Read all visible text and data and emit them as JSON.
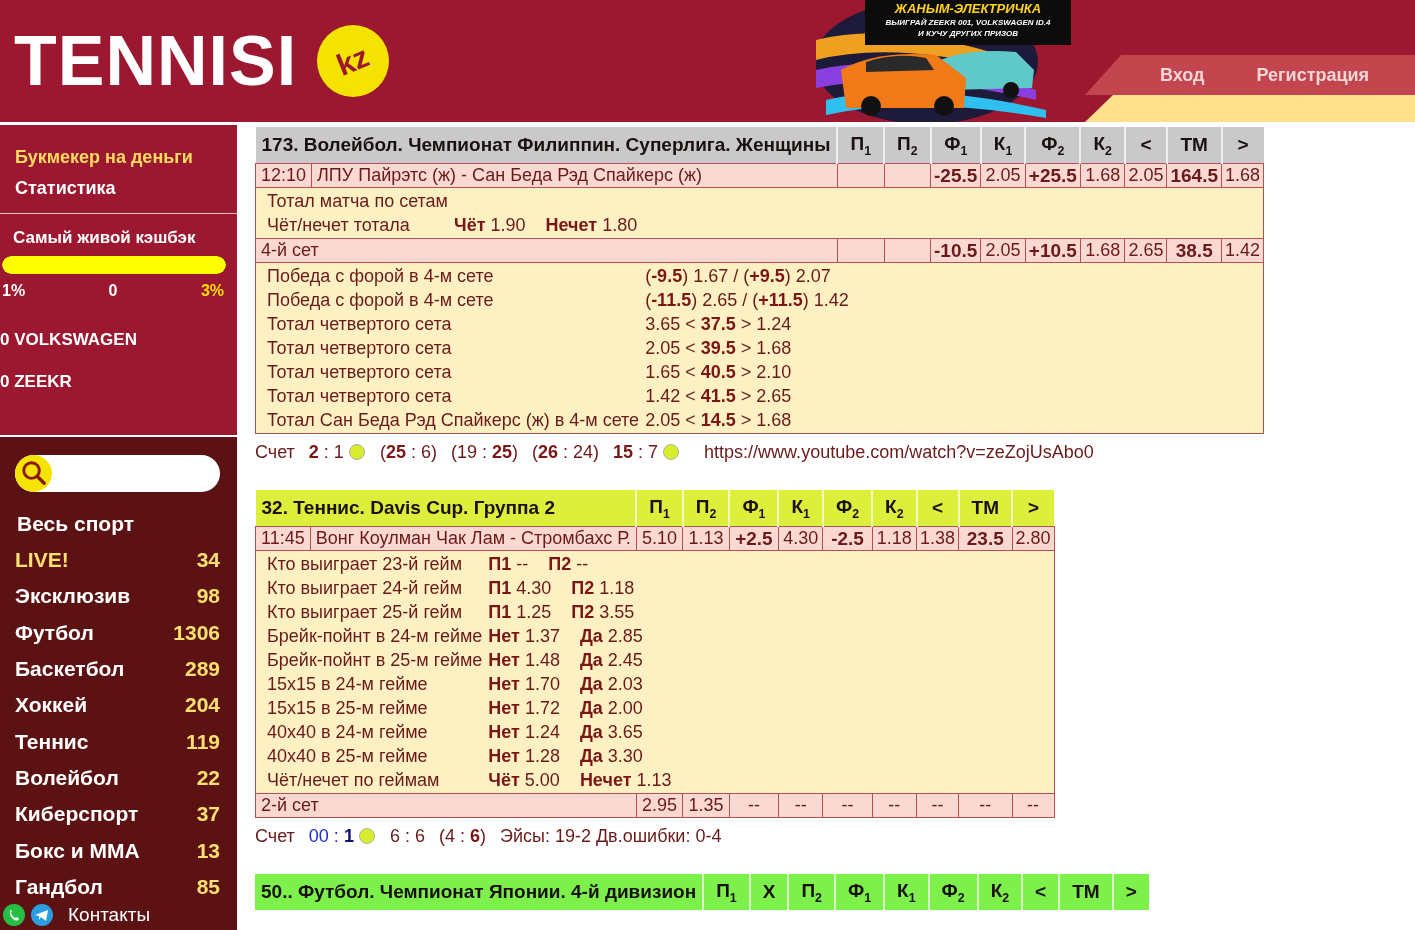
{
  "header": {
    "logo": "TENNISI",
    "badge": "kz",
    "promo": {
      "title": "ЖАНЫМ-ЭЛЕКТРИЧКА",
      "lines": [
        "ВЫИГРАЙ ZEEKR 001, VOLKSWAGEN ID.4",
        "И КУЧУ ДРУГИХ ПРИЗОВ"
      ]
    },
    "nav": [
      "Вход",
      "Регистрация"
    ]
  },
  "sidebar": {
    "links": [
      {
        "label": "Букмекер на деньги",
        "highlight": true
      },
      {
        "label": "Статистика",
        "highlight": false
      }
    ],
    "cashback": {
      "title": "Самый живой кэшбэк",
      "level": 1,
      "marks": [
        {
          "label": "1%",
          "highlight": false
        },
        {
          "label": "0",
          "highlight": false
        },
        {
          "label": "3%",
          "highlight": true
        }
      ],
      "prizes": [
        "0 VOLKSWAGEN",
        "0 ZEEKR"
      ]
    },
    "all_sports": "Весь спорт",
    "sports": [
      {
        "label": "LIVE!",
        "count": "34",
        "highlight": true
      },
      {
        "label": "Эксклюзив",
        "count": "98",
        "highlight": false
      },
      {
        "label": "Футбол",
        "count": "1306",
        "highlight": false
      },
      {
        "label": "Баскетбол",
        "count": "289",
        "highlight": false
      },
      {
        "label": "Хоккей",
        "count": "204",
        "highlight": false
      },
      {
        "label": "Теннис",
        "count": "119",
        "highlight": false
      },
      {
        "label": "Волейбол",
        "count": "22",
        "highlight": false
      },
      {
        "label": "Киберспорт",
        "count": "37",
        "highlight": false
      },
      {
        "label": "Бокс и MMA",
        "count": "13",
        "highlight": false
      },
      {
        "label": "Гандбол",
        "count": "85",
        "highlight": false
      }
    ],
    "contacts": "Контакты"
  },
  "events": [
    {
      "title": "173. Волейбол. Чемпионат Филиппин. Суперлига. Женщины",
      "color": "#c9c9c9",
      "columns": [
        "П$_{1}$",
        "П$_{2}$",
        "Ф$_{1}$",
        "К$_{1}$",
        "Ф$_{2}$",
        "К$_{2}$",
        "<",
        "ТМ",
        ">"
      ],
      "rows": [
        {
          "kind": "line",
          "time": "12:10",
          "name": "ЛПУ Пайрэтс (ж) - Сан Беда Рэд Спайкерс (ж)",
          "cells": [
            null,
            null,
            {
              "text": "-25.5",
              "bold": true
            },
            {
              "text": "2.05",
              "bold": false
            },
            {
              "text": "+25.5",
              "bold": true
            },
            {
              "text": "1.68",
              "bold": false
            },
            {
              "text": "2.05",
              "bold": false
            },
            {
              "text": "164.5",
              "bold": true
            },
            {
              "text": "1.68",
              "bold": false
            }
          ]
        },
        {
          "kind": "details",
          "lines": [
            {
              "label": "Тотал матча по сетам"
            },
            {
              "label": "Чёт/нечет тотала",
              "parts": [
                "**Чёт** 1.90",
                "**Нечет** 1.80"
              ]
            }
          ]
        },
        {
          "kind": "line",
          "name": "4-й сет",
          "cells": [
            null,
            null,
            {
              "text": "-10.5",
              "bold": true
            },
            {
              "text": "2.05",
              "bold": false
            },
            {
              "text": "+10.5",
              "bold": true
            },
            {
              "text": "1.68",
              "bold": false
            },
            {
              "text": "2.65",
              "bold": false
            },
            {
              "text": "38.5",
              "bold": true
            },
            {
              "text": "1.42",
              "bold": false
            }
          ]
        },
        {
          "kind": "details",
          "lines": [
            {
              "label": "Победа с форой в 4-м сете",
              "parts": [
                "(**-9.5**) 1.67 / (**+9.5**) 2.07"
              ]
            },
            {
              "label": "Победа с форой в 4-м сете",
              "parts": [
                "(**-11.5**) 2.65 / (**+11.5**) 1.42"
              ]
            },
            {
              "label": "Тотал четвертого сета",
              "parts": [
                "3.65 < **37.5** > 1.24"
              ]
            },
            {
              "label": "Тотал четвертого сета",
              "parts": [
                "2.05 < **39.5** > 1.68"
              ]
            },
            {
              "label": "Тотал четвертого сета",
              "parts": [
                "1.65 < **40.5** > 2.10"
              ]
            },
            {
              "label": "Тотал четвертого сета",
              "parts": [
                "1.42 < **41.5** > 2.65"
              ]
            },
            {
              "label": "Тотал Сан Беда Рэд Спайкерс (ж) в 4-м сете",
              "parts": [
                "2.05 < **14.5** > 1.68"
              ]
            }
          ]
        }
      ],
      "score": [
        {
          "kind": "label",
          "text": "Счет"
        },
        {
          "kind": "text",
          "text": "**2** : 1"
        },
        {
          "kind": "ball"
        },
        {
          "kind": "text",
          "text": "(**25** : 6)"
        },
        {
          "kind": "text",
          "text": "(19 : **25**)"
        },
        {
          "kind": "text",
          "text": "(**26** : 24)"
        },
        {
          "kind": "text",
          "text": "**15** : 7"
        },
        {
          "kind": "ball"
        },
        {
          "kind": "link",
          "text": "https://www.youtube.com/watch?v=zeZojUsAbo0"
        }
      ]
    },
    {
      "title": "32. Теннис. Davis Cup. Группа 2",
      "color": "#dcef3a",
      "columns": [
        "П$_{1}$",
        "П$_{2}$",
        "Ф$_{1}$",
        "К$_{1}$",
        "Ф$_{2}$",
        "К$_{2}$",
        "<",
        "ТМ",
        ">"
      ],
      "rows": [
        {
          "kind": "line",
          "time": "11:45",
          "name": "Вонг Коулман Чак Лам - Стромбахс Р.",
          "cells": [
            {
              "text": "5.10",
              "bold": false
            },
            {
              "text": "1.13",
              "bold": false
            },
            {
              "text": "+2.5",
              "bold": true
            },
            {
              "text": "4.30",
              "bold": false
            },
            {
              "text": "-2.5",
              "bold": true
            },
            {
              "text": "1.18",
              "bold": false
            },
            {
              "text": "1.38",
              "bold": false
            },
            {
              "text": "23.5",
              "bold": true
            },
            {
              "text": "2.80",
              "bold": false
            }
          ]
        },
        {
          "kind": "details",
          "lines": [
            {
              "label": "Кто выиграет 23-й гейм",
              "parts": [
                "**П1** --",
                "**П2** --"
              ]
            },
            {
              "label": "Кто выиграет 24-й гейм",
              "parts": [
                "**П1** 4.30",
                "**П2** 1.18"
              ]
            },
            {
              "label": "Кто выиграет 25-й гейм",
              "parts": [
                "**П1** 1.25",
                "**П2** 3.55"
              ]
            },
            {
              "label": "Брейк-пойнт в 24-м гейме",
              "parts": [
                "**Нет** 1.37",
                "**Да** 2.85"
              ]
            },
            {
              "label": "Брейк-пойнт в 25-м гейме",
              "parts": [
                "**Нет** 1.48",
                "**Да** 2.45"
              ]
            },
            {
              "label": "15x15 в 24-м гейме",
              "parts": [
                "**Нет** 1.70",
                "**Да** 2.03"
              ]
            },
            {
              "label": "15x15 в 25-м гейме",
              "parts": [
                "**Нет** 1.72",
                "**Да** 2.00"
              ]
            },
            {
              "label": "40x40 в 24-м гейме",
              "parts": [
                "**Нет** 1.24",
                "**Да** 3.65"
              ]
            },
            {
              "label": "40x40 в 25-м гейме",
              "parts": [
                "**Нет** 1.28",
                "**Да** 3.30"
              ]
            },
            {
              "label": "Чёт/нечет по геймам",
              "parts": [
                "**Чёт** 5.00",
                "**Нечет** 1.13"
              ]
            }
          ]
        },
        {
          "kind": "line",
          "name": "2-й сет",
          "cells": [
            {
              "text": "2.95",
              "bold": false
            },
            {
              "text": "1.35",
              "bold": false
            },
            {
              "text": "--",
              "bold": false
            },
            {
              "text": "--",
              "bold": false
            },
            {
              "text": "--",
              "bold": false
            },
            {
              "text": "--",
              "bold": false
            },
            {
              "text": "--",
              "bold": false
            },
            {
              "text": "--",
              "bold": false
            },
            {
              "text": "--",
              "bold": false
            }
          ]
        }
      ],
      "score": [
        {
          "kind": "label",
          "text": "Счет"
        },
        {
          "kind": "set",
          "text": "00 : **1**"
        },
        {
          "kind": "ball"
        },
        {
          "kind": "text",
          "text": "6 : 6"
        },
        {
          "kind": "text",
          "text": "(4 : **6**)"
        },
        {
          "kind": "text",
          "text": "Эйсы: 19-2 Дв.ошибки: 0-4"
        }
      ]
    },
    {
      "title": "50.. Футбол. Чемпионат Японии. 4-й дивизион",
      "color": "#7df04c",
      "columns": [
        "П$_{1}$",
        "Х",
        "П$_{2}$",
        "Ф$_{1}$",
        "К$_{1}$",
        "Ф$_{2}$",
        "К$_{2}$",
        "<",
        "ТМ",
        ">"
      ]
    }
  ]
}
